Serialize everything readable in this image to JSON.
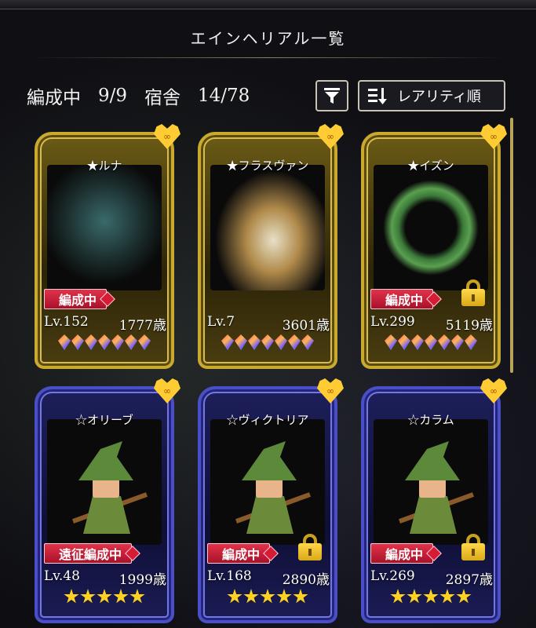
{
  "header": {
    "title": "エインヘリアル一覧"
  },
  "info": {
    "party_label": "編成中",
    "party_count": "9/9",
    "dorm_label": "宿舎",
    "dorm_count": "14/78"
  },
  "controls": {
    "filter_icon": "filter-funnel-icon",
    "sort_icon": "sort-list-icon",
    "sort_label": "レアリティ順"
  },
  "colors": {
    "gold_frame": "#c9a92e",
    "blue_frame": "#4a4fc7",
    "badge_red": "#d81a34",
    "star_yellow": "#ffd21e"
  },
  "cards": [
    {
      "name": "★ルナ",
      "badge": "編成中",
      "level": "Lv.152",
      "age": "1777歳",
      "frame": "gold",
      "rarity_icon": "rainbow-gem",
      "rarity_count": 7,
      "locked": false
    },
    {
      "name": "★フラスヴァン",
      "badge": "",
      "level": "Lv.7",
      "age": "3601歳",
      "frame": "gold",
      "rarity_icon": "rainbow-gem",
      "rarity_count": 7,
      "locked": false
    },
    {
      "name": "★イズン",
      "badge": "編成中",
      "level": "Lv.299",
      "age": "5119歳",
      "frame": "gold",
      "rarity_icon": "rainbow-gem",
      "rarity_count": 7,
      "locked": true
    },
    {
      "name": "☆オリーブ",
      "badge": "遠征編成中",
      "level": "Lv.48",
      "age": "1999歳",
      "frame": "blue",
      "rarity_icon": "star",
      "rarity_count": 5,
      "locked": false
    },
    {
      "name": "☆ヴィクトリア",
      "badge": "編成中",
      "level": "Lv.168",
      "age": "2890歳",
      "frame": "blue",
      "rarity_icon": "star",
      "rarity_count": 5,
      "locked": true
    },
    {
      "name": "☆カラム",
      "badge": "編成中",
      "level": "Lv.269",
      "age": "2897歳",
      "frame": "blue",
      "rarity_icon": "star",
      "rarity_count": 5,
      "locked": true
    }
  ]
}
